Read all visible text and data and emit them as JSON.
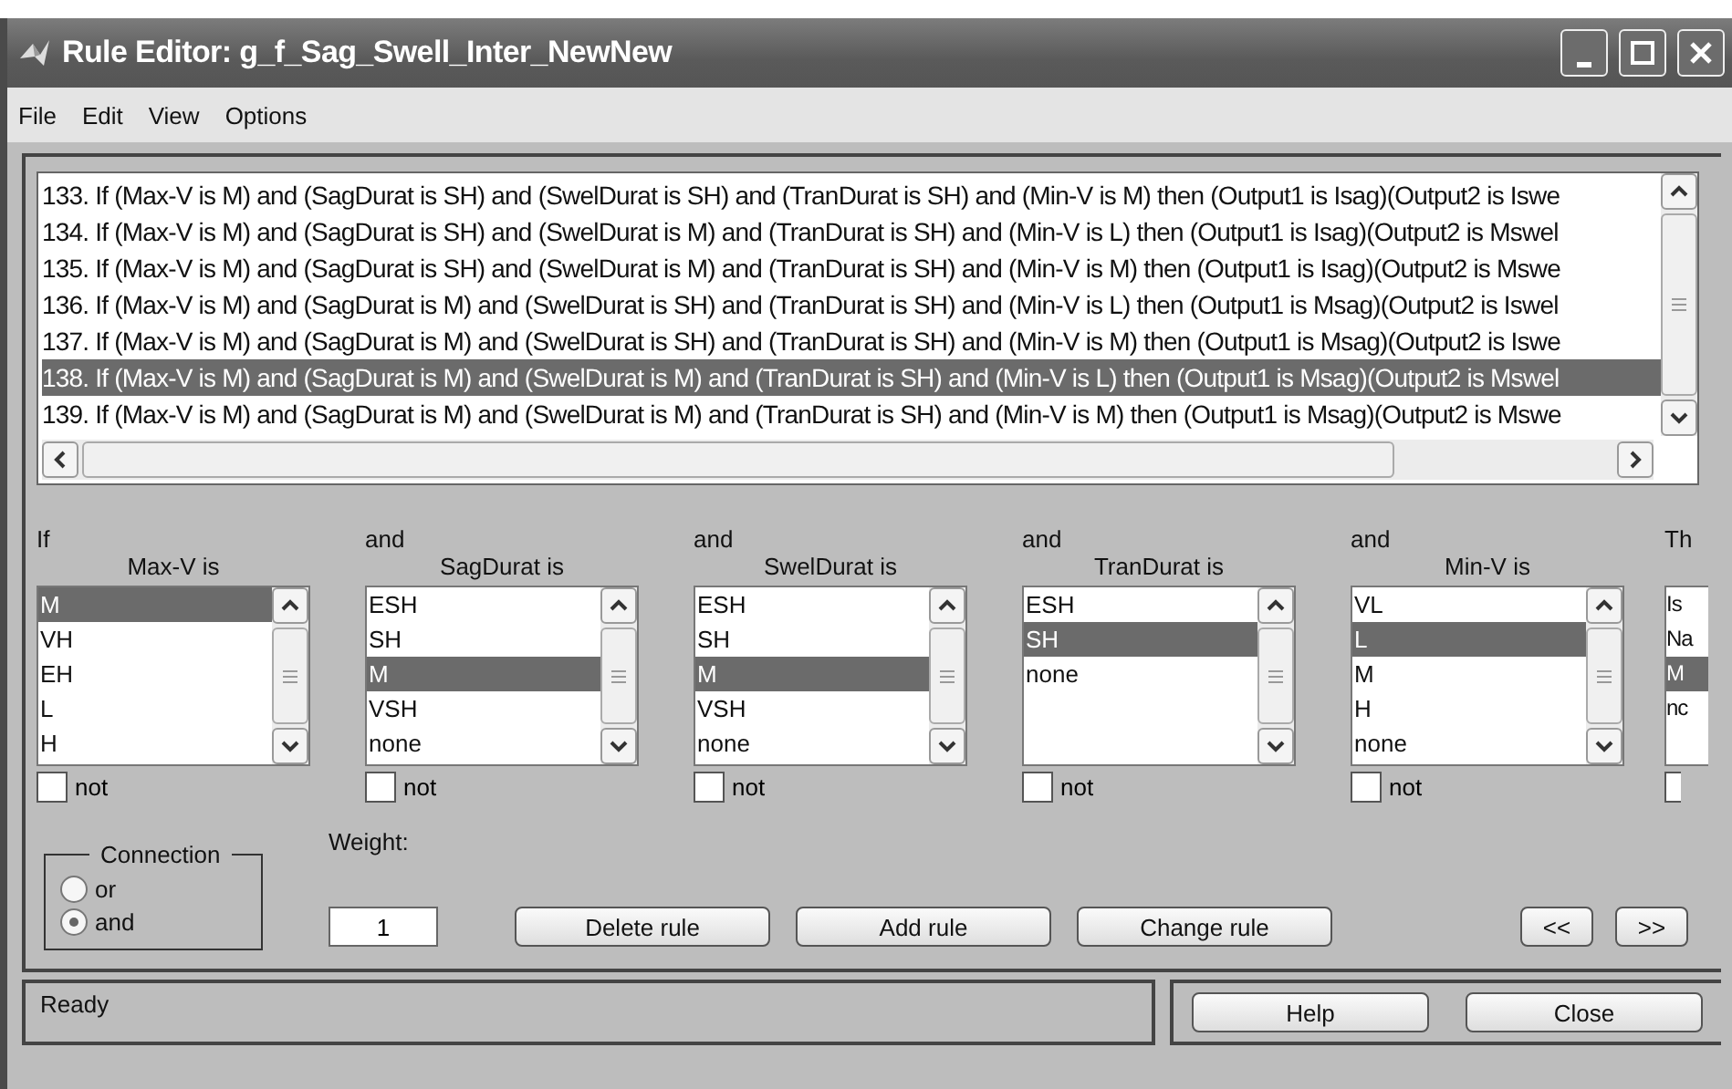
{
  "window": {
    "title": "Rule Editor: g_f_Sag_Swell_Inter_NewNew"
  },
  "menu": [
    "File",
    "Edit",
    "View",
    "Options"
  ],
  "rules": [
    {
      "text": "133. If (Max-V is M) and (SagDurat is SH) and (SwelDurat is SH) and (TranDurat is SH) and (Min-V is M) then (Output1 is Isag)(Output2 is Iswe",
      "selected": false
    },
    {
      "text": "134. If (Max-V is M) and (SagDurat is SH) and (SwelDurat is M) and (TranDurat is SH) and (Min-V is L) then (Output1 is Isag)(Output2 is Mswel",
      "selected": false
    },
    {
      "text": "135. If (Max-V is M) and (SagDurat is SH) and (SwelDurat is M) and (TranDurat is SH) and (Min-V is M) then (Output1 is Isag)(Output2 is Mswe",
      "selected": false
    },
    {
      "text": "136. If (Max-V is M) and (SagDurat is M) and (SwelDurat is SH) and (TranDurat is SH) and (Min-V is L) then (Output1 is Msag)(Output2 is Iswel",
      "selected": false
    },
    {
      "text": "137. If (Max-V is M) and (SagDurat is M) and (SwelDurat is SH) and (TranDurat is SH) and (Min-V is M) then (Output1 is Msag)(Output2 is Iswe",
      "selected": false
    },
    {
      "text": "138. If (Max-V is M) and (SagDurat is M) and (SwelDurat is M) and (TranDurat is SH) and (Min-V is L) then (Output1 is Msag)(Output2 is Mswel",
      "selected": true
    },
    {
      "text": "139. If (Max-V is M) and (SagDurat is M) and (SwelDurat is M) and (TranDurat is SH) and (Min-V is M) then (Output1 is Msag)(Output2 is Mswe",
      "selected": false
    }
  ],
  "inputs": [
    {
      "connector": "If",
      "label": "Max-V is",
      "not": false,
      "not_label": "not",
      "options": [
        {
          "label": "M",
          "selected": true
        },
        {
          "label": "VH",
          "selected": false
        },
        {
          "label": "EH",
          "selected": false
        },
        {
          "label": "L",
          "selected": false
        },
        {
          "label": "H",
          "selected": false
        }
      ]
    },
    {
      "connector": "and",
      "label": "SagDurat is",
      "not": false,
      "not_label": "not",
      "options": [
        {
          "label": "ESH",
          "selected": false
        },
        {
          "label": "SH",
          "selected": false
        },
        {
          "label": "M",
          "selected": true
        },
        {
          "label": "VSH",
          "selected": false
        },
        {
          "label": "none",
          "selected": false
        }
      ]
    },
    {
      "connector": "and",
      "label": "SwelDurat is",
      "not": false,
      "not_label": "not",
      "options": [
        {
          "label": "ESH",
          "selected": false
        },
        {
          "label": "SH",
          "selected": false
        },
        {
          "label": "M",
          "selected": true
        },
        {
          "label": "VSH",
          "selected": false
        },
        {
          "label": "none",
          "selected": false
        }
      ]
    },
    {
      "connector": "and",
      "label": "TranDurat is",
      "not": false,
      "not_label": "not",
      "options": [
        {
          "label": "ESH",
          "selected": false
        },
        {
          "label": "SH",
          "selected": true
        },
        {
          "label": "none",
          "selected": false
        }
      ]
    },
    {
      "connector": "and",
      "label": "Min-V is",
      "not": false,
      "not_label": "not",
      "options": [
        {
          "label": "VL",
          "selected": false
        },
        {
          "label": "L",
          "selected": true
        },
        {
          "label": "M",
          "selected": false
        },
        {
          "label": "H",
          "selected": false
        },
        {
          "label": "none",
          "selected": false
        }
      ]
    }
  ],
  "output_partial": {
    "connector": "Th",
    "not": false,
    "options": [
      {
        "label": "Is",
        "selected": false
      },
      {
        "label": "Na",
        "selected": false
      },
      {
        "label": "M",
        "selected": true
      },
      {
        "label": "nc",
        "selected": false
      }
    ]
  },
  "connection": {
    "title": "Connection",
    "options": [
      {
        "label": "or",
        "selected": false
      },
      {
        "label": "and",
        "selected": true
      }
    ]
  },
  "weight": {
    "label": "Weight:",
    "value": "1"
  },
  "actions": [
    "Delete rule",
    "Add rule",
    "Change rule"
  ],
  "nav": [
    "<<",
    ">>"
  ],
  "status": "Ready",
  "footer_buttons": [
    "Help",
    "Close"
  ]
}
